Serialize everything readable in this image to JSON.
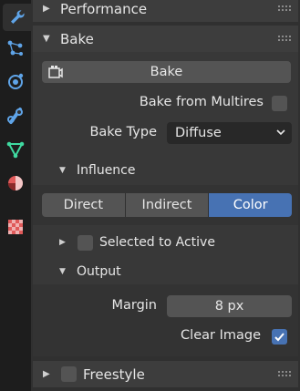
{
  "tabs": [
    {
      "name": "tool",
      "icon": "wrench-icon",
      "color": "#5fa4e8"
    },
    {
      "name": "particles",
      "icon": "particles-icon",
      "color": "#5fa4e8"
    },
    {
      "name": "physics",
      "icon": "physics-icon",
      "color": "#5fa4e8"
    },
    {
      "name": "constraints",
      "icon": "constraints-icon",
      "color": "#5fa4e8"
    },
    {
      "name": "data",
      "icon": "vertex-data-icon",
      "color": "#3fd9a0"
    },
    {
      "name": "material",
      "icon": "material-icon",
      "color": "#e05a5a"
    },
    {
      "name": "texture",
      "icon": "checker-texture-icon",
      "color": "#e05a5a"
    }
  ],
  "panels": {
    "performance": {
      "title": "Performance",
      "collapsed": true
    },
    "bake": {
      "title": "Bake",
      "bake_button": "Bake",
      "bake_from_multires_label": "Bake from Multires",
      "bake_from_multires": false,
      "bake_type_label": "Bake Type",
      "bake_type_value": "Diffuse",
      "influence": {
        "title": "Influence",
        "options": [
          "Direct",
          "Indirect",
          "Color"
        ],
        "active": "Color"
      },
      "selected_to_active": {
        "title": "Selected to Active",
        "enabled": false,
        "collapsed": true
      },
      "output": {
        "title": "Output",
        "margin_label": "Margin",
        "margin_value": "8 px",
        "clear_image_label": "Clear Image",
        "clear_image": true
      }
    },
    "freestyle": {
      "title": "Freestyle",
      "enabled": false,
      "collapsed": true
    }
  },
  "colors": {
    "accent": "#4772b3",
    "panel": "#383838",
    "header": "#3d3d3d"
  }
}
